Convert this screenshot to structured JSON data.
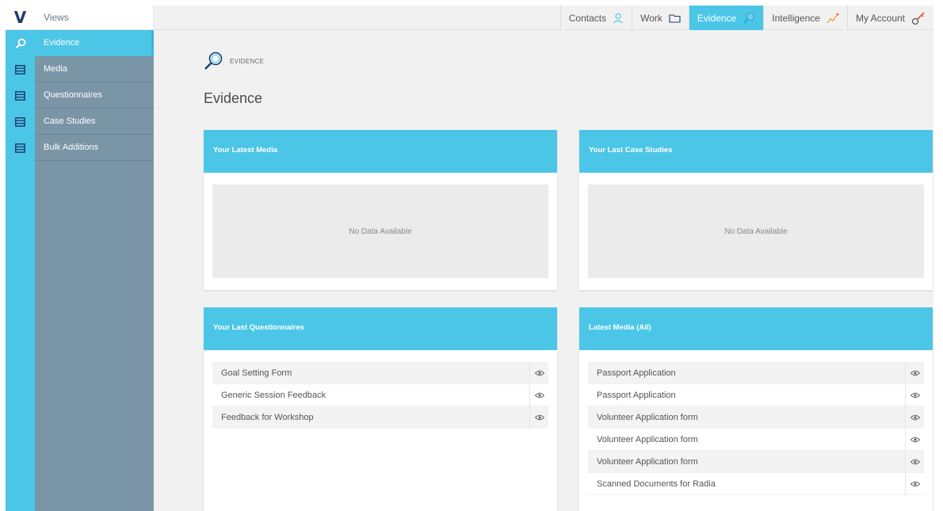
{
  "logo": "V",
  "sidebar": {
    "header": "Views",
    "items": [
      {
        "label": "Evidence",
        "icon": "search-icon"
      },
      {
        "label": "Media",
        "icon": "list-icon"
      },
      {
        "label": "Questionnaires",
        "icon": "list-icon"
      },
      {
        "label": "Case Studies",
        "icon": "list-icon"
      },
      {
        "label": "Bulk Additions",
        "icon": "list-icon"
      }
    ]
  },
  "topnav": {
    "items": [
      {
        "label": "Contacts",
        "icon": "user-icon"
      },
      {
        "label": "Work",
        "icon": "folder-icon"
      },
      {
        "label": "Evidence",
        "icon": "search-icon"
      },
      {
        "label": "Intelligence",
        "icon": "chart-line-icon"
      },
      {
        "label": "My Account",
        "icon": "key-icon"
      }
    ]
  },
  "breadcrumb": "EVIDENCE",
  "page_title": "Evidence",
  "cards": {
    "latest_media": {
      "title": "Your Latest Media",
      "empty_text": "No Data Available"
    },
    "last_case_studies": {
      "title": "Your Last Case Studies",
      "empty_text": "No Data Available"
    },
    "last_questionnaires": {
      "title": "Your Last Questionnaires",
      "rows": [
        "Goal Setting Form",
        "Generic Session Feedback",
        "Feedback for Workshop"
      ]
    },
    "latest_media_all": {
      "title": "Latest Media (All)",
      "rows": [
        "Passport Application",
        "Passport Application",
        "Volunteer Application form",
        "Volunteer Application form",
        "Volunteer Application form",
        "Scanned Documents for Radia"
      ]
    }
  },
  "colors": {
    "accent": "#4cc6e7",
    "sidebar": "#7a95a6",
    "background": "#f1f1f1"
  }
}
